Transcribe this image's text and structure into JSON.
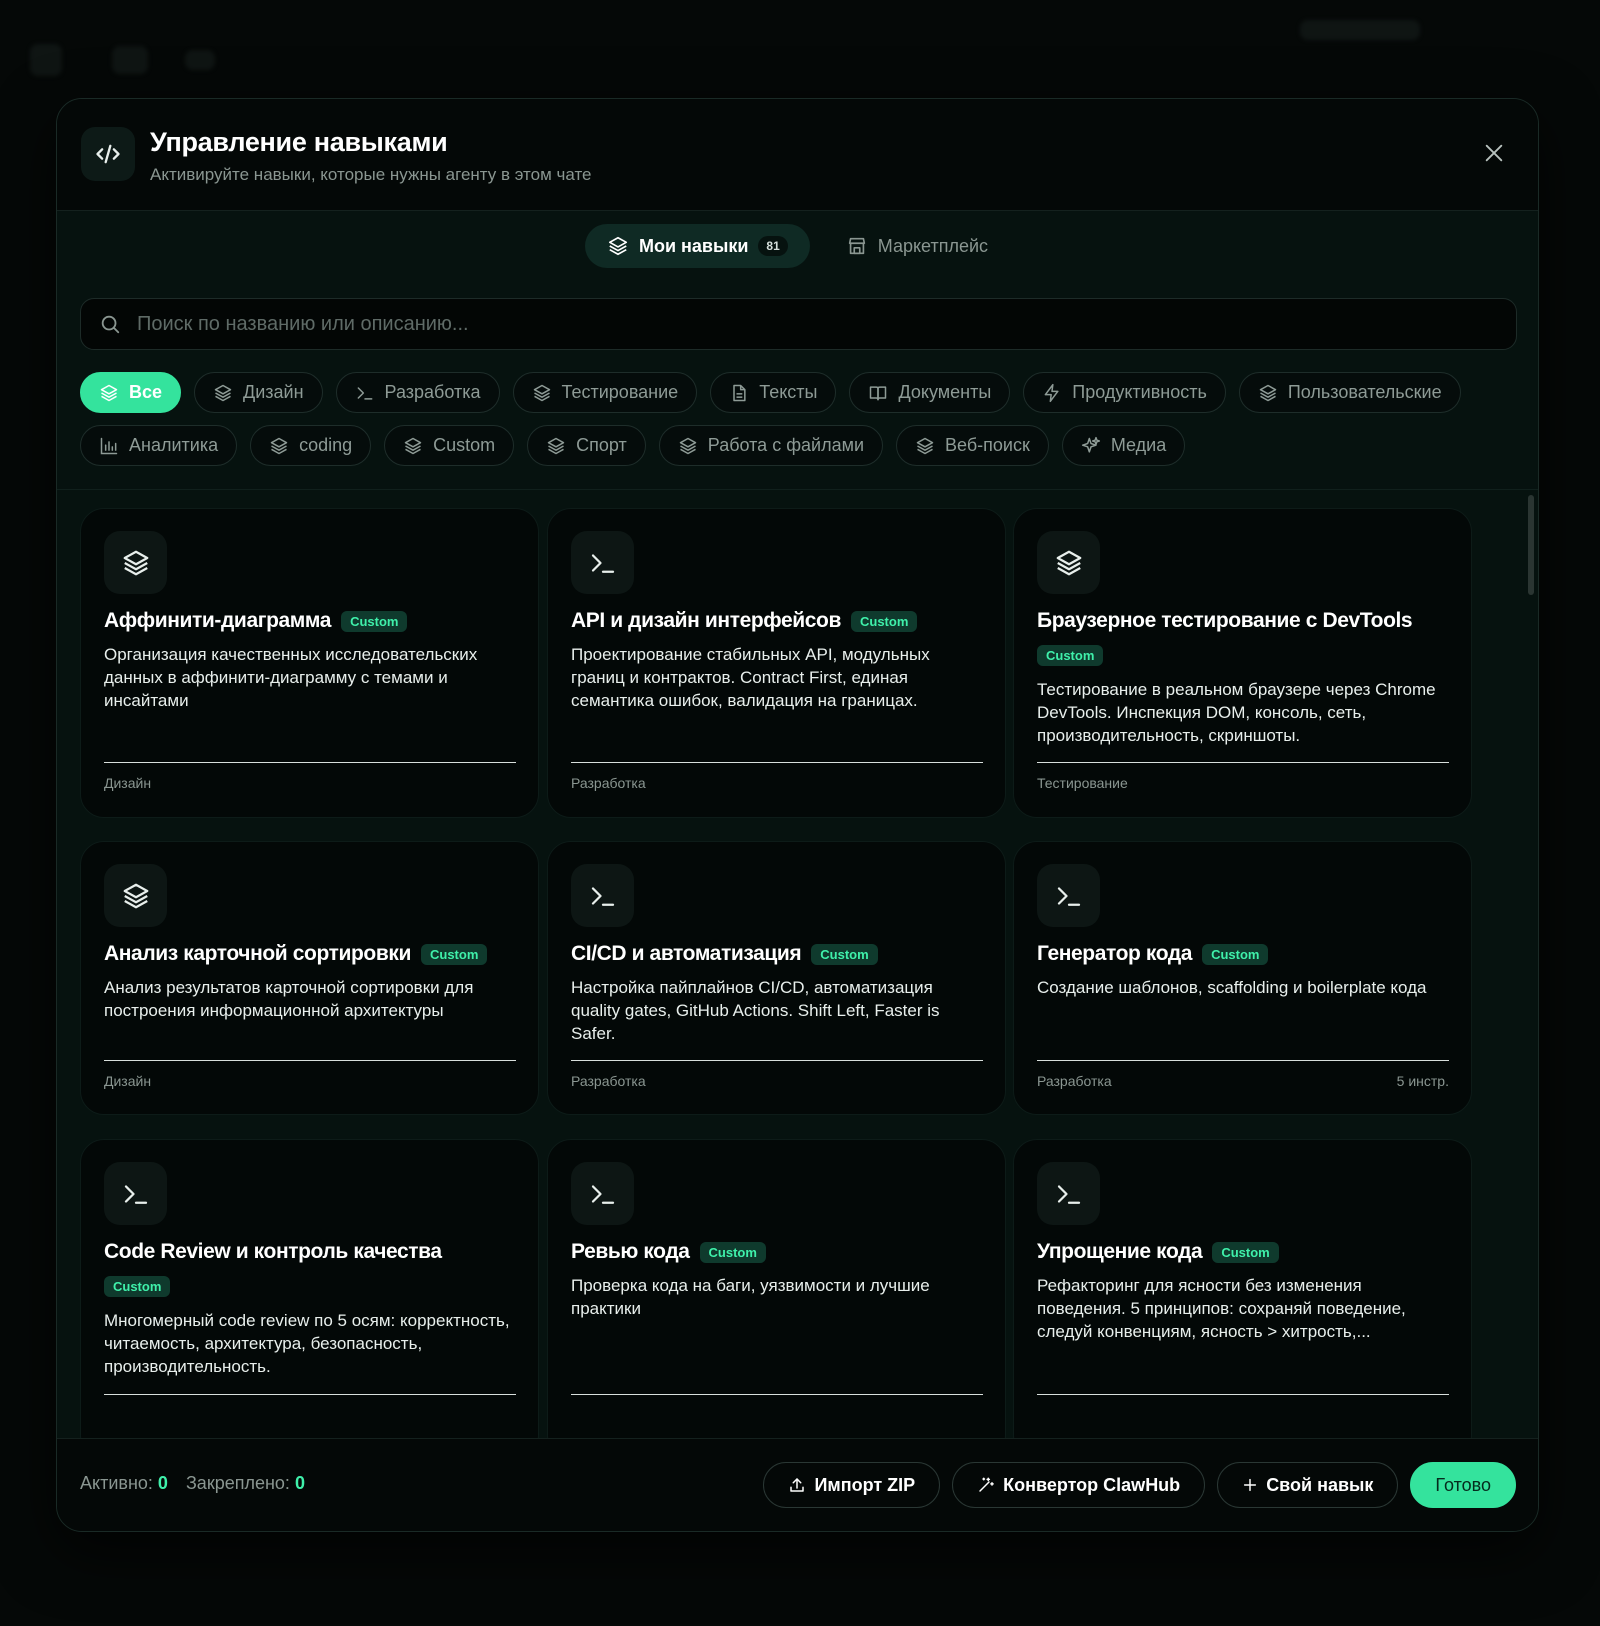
{
  "header": {
    "title": "Управление навыками",
    "subtitle": "Активируйте навыки, которые нужны агенту в этом чате",
    "icon": "code-icon"
  },
  "tabs": [
    {
      "label": "Мои навыки",
      "count": "81",
      "active": true,
      "icon": "layers-icon"
    },
    {
      "label": "Маркетплейс",
      "active": false,
      "icon": "store-icon"
    }
  ],
  "search": {
    "placeholder": "Поиск по названию или описанию..."
  },
  "filters": [
    {
      "label": "Все",
      "icon": "layers-icon",
      "active": true
    },
    {
      "label": "Дизайн",
      "icon": "layers-icon"
    },
    {
      "label": "Разработка",
      "icon": "terminal-icon"
    },
    {
      "label": "Тестирование",
      "icon": "layers-icon"
    },
    {
      "label": "Тексты",
      "icon": "document-icon"
    },
    {
      "label": "Документы",
      "icon": "book-icon"
    },
    {
      "label": "Продуктивность",
      "icon": "bolt-icon"
    },
    {
      "label": "Пользовательские",
      "icon": "layers-icon"
    },
    {
      "label": "Аналитика",
      "icon": "chart-icon"
    },
    {
      "label": "coding",
      "icon": "layers-icon"
    },
    {
      "label": "Custom",
      "icon": "layers-icon"
    },
    {
      "label": "Спорт",
      "icon": "layers-icon"
    },
    {
      "label": "Работа с файлами",
      "icon": "layers-icon"
    },
    {
      "label": "Веб-поиск",
      "icon": "layers-icon"
    },
    {
      "label": "Медиа",
      "icon": "sparkles-icon"
    }
  ],
  "cards": [
    {
      "icon": "layers-icon",
      "title": "Аффинити-диаграмма",
      "badge": "Custom",
      "desc": "Организация качественных исследовательских данных в аффинити-диаграмму с темами и инсайтами",
      "category": "Дизайн",
      "extra": ""
    },
    {
      "icon": "terminal-icon",
      "title": "API и дизайн интерфейсов",
      "badge": "Custom",
      "desc": "Проектирование стабильных API, модульных границ и контрактов. Contract First, единая семантика ошибок, валидация на границах.",
      "category": "Разработка",
      "extra": ""
    },
    {
      "icon": "layers-icon",
      "title": "Браузерное тестирование с DevTools",
      "badge": "Custom",
      "desc": "Тестирование в реальном браузере через Chrome DevTools. Инспекция DOM, консоль, сеть, производительность, скриншоты.",
      "category": "Тестирование",
      "extra": ""
    },
    {
      "icon": "layers-icon",
      "title": "Анализ карточной сортировки",
      "badge": "Custom",
      "desc": "Анализ результатов карточной сортировки для построения информационной архитектуры",
      "category": "Дизайн",
      "extra": ""
    },
    {
      "icon": "terminal-icon",
      "title": "CI/CD и автоматизация",
      "badge": "Custom",
      "desc": "Настройка пайплайнов CI/CD, автоматизация quality gates, GitHub Actions. Shift Left, Faster is Safer.",
      "category": "Разработка",
      "extra": ""
    },
    {
      "icon": "terminal-icon",
      "title": "Генератор кода",
      "badge": "Custom",
      "desc": "Создание шаблонов, scaffolding и boilerplate кода",
      "category": "Разработка",
      "extra": "5 инстр."
    },
    {
      "icon": "terminal-icon",
      "title": "Code Review и контроль качества",
      "badge": "Custom",
      "desc": "Многомерный code review по 5 осям: корректность, читаемость, архитектура, безопасность, производительность.",
      "category": "",
      "extra": ""
    },
    {
      "icon": "terminal-icon",
      "title": "Ревью кода",
      "badge": "Custom",
      "desc": "Проверка кода на баги, уязвимости и лучшие практики",
      "category": "",
      "extra": ""
    },
    {
      "icon": "terminal-icon",
      "title": "Упрощение кода",
      "badge": "Custom",
      "desc": "Рефакторинг для ясности без изменения поведения. 5 принципов: сохраняй поведение, следуй конвенциям, ясность > хитрость,...",
      "category": "",
      "extra": ""
    }
  ],
  "footer": {
    "active_label": "Активно:",
    "active_value": "0",
    "pinned_label": "Закреплено:",
    "pinned_value": "0",
    "import_label": "Импорт ZIP",
    "converter_label": "Конвертор ClawHub",
    "custom_label": "Свой навык",
    "done_label": "Готово"
  },
  "colors": {
    "accent": "#34e39d",
    "badge_text": "#3ff0aa",
    "background": "#06120f"
  }
}
